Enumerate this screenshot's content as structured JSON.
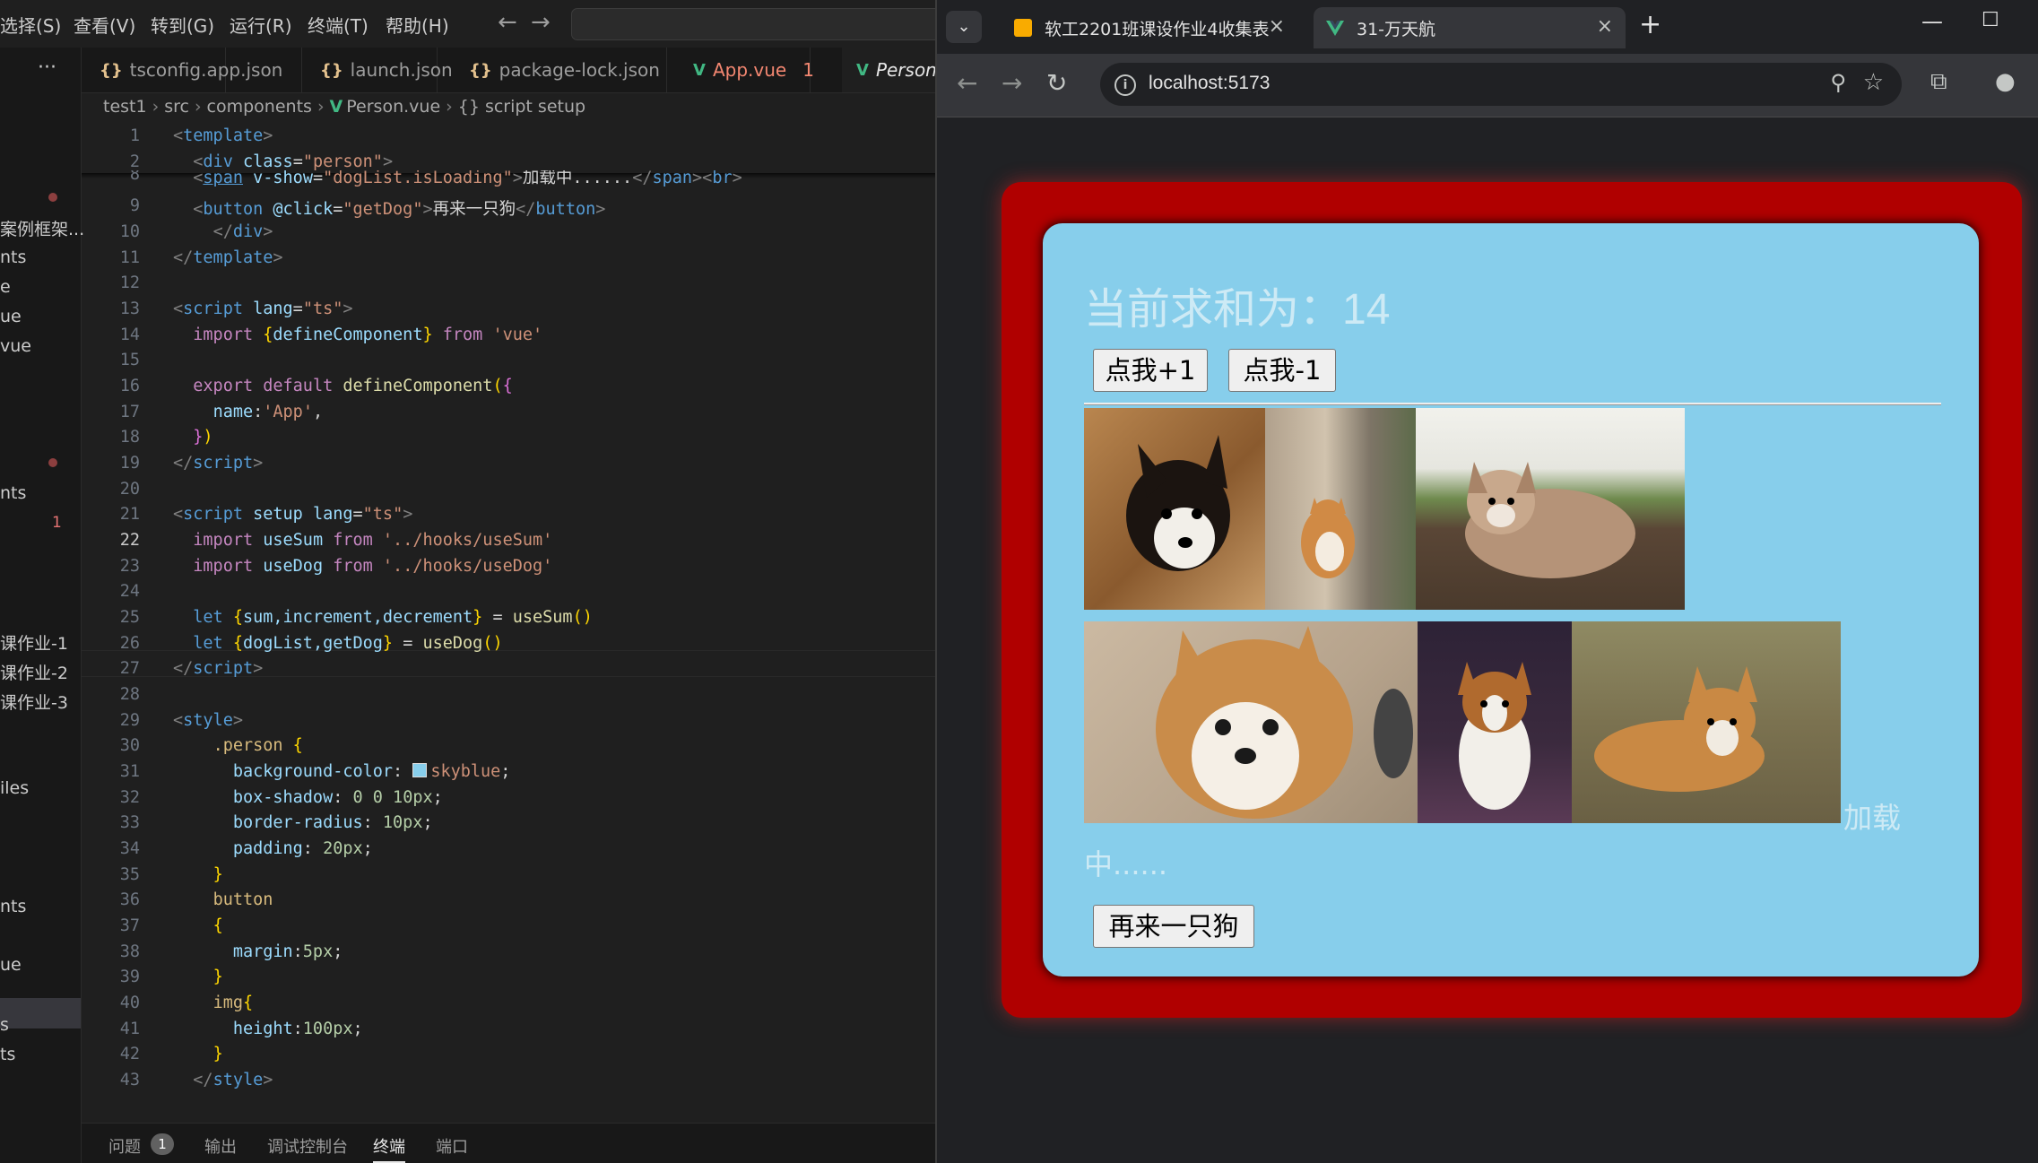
{
  "vscode": {
    "menu": [
      "选择(S)",
      "查看(V)",
      "转到(G)",
      "运行(R)",
      "终端(T)",
      "帮助(H)"
    ],
    "sidebar": {
      "more": "···",
      "items": [
        "案例框架...",
        "nts",
        "e",
        "ue",
        "vue",
        "nts",
        "1",
        "课作业-1",
        "课作业-2",
        "课作业-3",
        "iles",
        "nts",
        "ue",
        "s",
        "ts"
      ]
    },
    "tabs": [
      {
        "icon": "{}",
        "label": "tsconfig.app.json"
      },
      {
        "icon": "{}",
        "label": "launch.json"
      },
      {
        "icon": "{}",
        "label": "package-lock.json"
      },
      {
        "icon": "V",
        "label": "App.vue",
        "badge": "1"
      },
      {
        "icon": "V",
        "label": "Person"
      }
    ],
    "breadcrumb": [
      "test1",
      "src",
      "components",
      "Person.vue",
      "script setup"
    ],
    "line_numbers": [
      "1",
      "2",
      "8",
      "9",
      "10",
      "11",
      "12",
      "13",
      "14",
      "15",
      "16",
      "17",
      "18",
      "19",
      "20",
      "21",
      "22",
      "23",
      "24",
      "25",
      "26",
      "27",
      "28",
      "29",
      "30",
      "31",
      "32",
      "33",
      "34",
      "35",
      "36",
      "37",
      "38",
      "39",
      "40",
      "41",
      "42",
      "43"
    ],
    "code": {
      "l1_tag": "template",
      "l2_tag": "div",
      "l2_attr": "class",
      "l2_val": "\"person\"",
      "l8_tag": "span",
      "l8_attr": "v-show",
      "l8_val": "\"dogList.isLoading\"",
      "l8_text": "加载中......",
      "l8_end": "span",
      "l8_br": "br",
      "l9_tag": "button",
      "l9_attr": "@click",
      "l9_val": "\"getDog\"",
      "l9_text": "再来一只狗",
      "l9_end": "button",
      "l10_tag": "div",
      "l11_tag": "template",
      "l13_tag": "script",
      "l13_attr": "lang",
      "l13_val": "\"ts\"",
      "l14_kw": "import",
      "l14_name": "defineComponent",
      "l14_from": "from",
      "l14_str": "'vue'",
      "l16_kw": "export",
      "l16_kw2": "default",
      "l16_fn": "defineComponent",
      "l17_prop": "name",
      "l17_str": "'App'",
      "l19_tag": "script",
      "l21_tag": "script",
      "l21_attr1": "setup",
      "l21_attr2": "lang",
      "l21_val": "\"ts\"",
      "l22_kw": "import",
      "l22_name": "useSum",
      "l22_from": "from",
      "l22_str": "'../hooks/useSum'",
      "l23_kw": "import",
      "l23_name": "useDog",
      "l23_from": "from",
      "l23_str": "'../hooks/useDog'",
      "l25_kw": "let",
      "l25_vars": "sum,increment,decrement",
      "l25_fn": "useSum",
      "l26_kw": "let",
      "l26_vars": "dogList,getDog",
      "l26_fn": "useDog",
      "l27_tag": "script",
      "l29_tag": "style",
      "l30_sel": ".person",
      "l31_prop": "background-color",
      "l31_val": "skyblue",
      "l32_prop": "box-shadow",
      "l32_val": "0 0 10px",
      "l33_prop": "border-radius",
      "l33_val": "10px",
      "l34_prop": "padding",
      "l34_val": "20px",
      "l36_sel": "button",
      "l38_prop": "margin",
      "l38_val": "5px",
      "l40_sel": "img",
      "l41_prop": "height",
      "l41_val": "100px",
      "l43_tag": "style"
    },
    "panel": {
      "tabs": [
        "问题",
        "输出",
        "调试控制台",
        "终端",
        "端口"
      ],
      "problems_count": "1",
      "active": "终端"
    }
  },
  "browser": {
    "tabs": [
      {
        "title": "软工2201班课设作业4收集表",
        "favicon": "yellow-form-icon",
        "close": "×"
      },
      {
        "title": "31-万天航",
        "favicon": "vue-icon",
        "close": "×"
      }
    ],
    "new_tab": "+",
    "window_controls": [
      "—",
      "☐"
    ],
    "url": "localhost:5173",
    "page": {
      "sum_label": "当前求和为：14",
      "increment_button": "点我+1",
      "decrement_button": "点我-1",
      "dogs": [
        "corgi-photo-1",
        "corgi-photo-2",
        "corgi-photo-3",
        "corgi-photo-4",
        "corgi-photo-5",
        "corgi-photo-6"
      ],
      "loading_text_a": "加载",
      "loading_text_b": "中......",
      "more_dog_button": "再来一只狗",
      "colors": {
        "frame": "#b00000",
        "person_bg": "#87ceeb"
      }
    }
  }
}
